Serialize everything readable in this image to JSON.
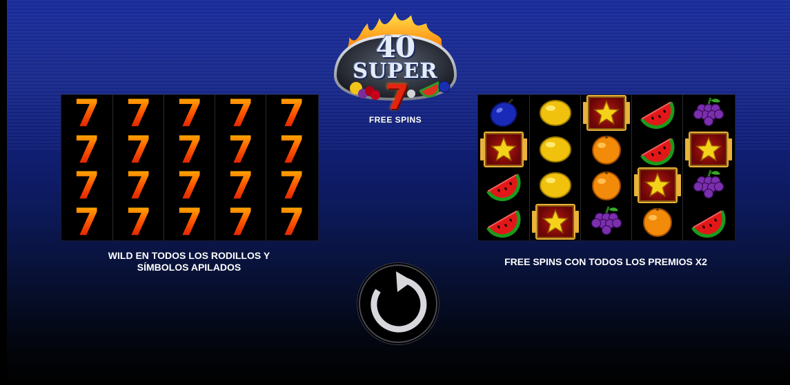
{
  "logo": {
    "number": "40",
    "word": "SUPER",
    "seven": "7",
    "subtitle": "FREE SPINS"
  },
  "left_feature": {
    "reels": [
      [
        "7",
        "7",
        "7",
        "7"
      ],
      [
        "7",
        "7",
        "7",
        "7"
      ],
      [
        "7",
        "7",
        "7",
        "7"
      ],
      [
        "7",
        "7",
        "7",
        "7"
      ],
      [
        "7",
        "7",
        "7",
        "7"
      ]
    ],
    "caption_line1": "WILD EN TODOS LOS RODILLOS Y",
    "caption_line2": "SÍMBOLOS APILADOS"
  },
  "right_feature": {
    "reels": [
      [
        "plum",
        "star",
        "watermelon",
        "watermelon"
      ],
      [
        "lemon",
        "lemon",
        "lemon",
        "star"
      ],
      [
        "star",
        "orange",
        "orange",
        "grapes"
      ],
      [
        "watermelon",
        "watermelon",
        "star",
        "orange"
      ],
      [
        "grapes",
        "star",
        "grapes",
        "watermelon"
      ]
    ],
    "caption": "FREE SPINS CON TODOS LOS PREMIOS X2"
  },
  "spin_button": {
    "icon": "spin-arrow-icon"
  },
  "colors": {
    "background_top": "#1a2c9a",
    "background_bottom": "#000000",
    "seven_red": "#e52410",
    "star_gold": "#f5d21a",
    "frame_gold": "#e9b23a"
  }
}
